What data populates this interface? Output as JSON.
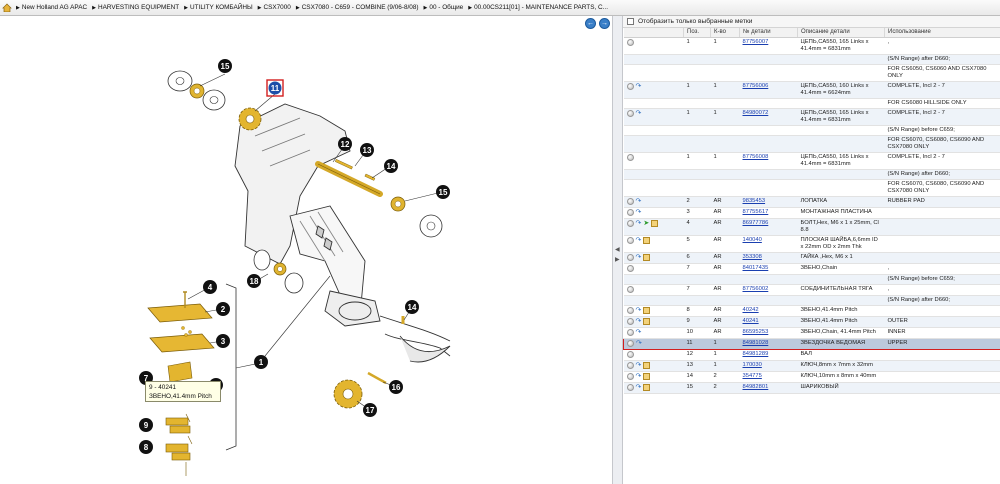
{
  "breadcrumb": [
    "New Holland AG APAC",
    "HARVESTING EQUIPMENT",
    "UTILITY КОМБАЙНЫ",
    "CSX7000",
    "CSX7080 - C659 - COMBINE (9/06-8/08)",
    "00 - Общие",
    "00.00CS211[01] - MAINTENANCE PARTS, C..."
  ],
  "diagram": {
    "callouts": [
      "15",
      "11",
      "12",
      "13",
      "14",
      "15",
      "18",
      "4",
      "2",
      "3",
      "1",
      "7",
      "5",
      "9",
      "8",
      "14",
      "16",
      "17"
    ],
    "tooltip_line1": "9 - 40241",
    "tooltip_line2": "ЗВЕНО,41.4mm Pitch",
    "nav_prev": "←",
    "nav_next": "→"
  },
  "filter": {
    "label": "Отобразить только выбранные метки"
  },
  "table": {
    "headers": [
      "",
      "Поз.",
      "К-во",
      "№ детали",
      "Описание детали",
      "Использование"
    ],
    "rows": [
      {
        "icons": [
          "circle"
        ],
        "pos": "1",
        "qty": "1",
        "part": "87756007",
        "desc": "ЦЕПЬ,CA550, 165 Links x 41.4mm = 6831mm",
        "use": ","
      },
      {
        "icons": [],
        "pos": "",
        "qty": "",
        "part": "",
        "desc": "",
        "use": "(S/N Range) after D660;"
      },
      {
        "icons": [],
        "pos": "",
        "qty": "",
        "part": "",
        "desc": "",
        "use": "FOR CS6050, CS6060 AND CSX7080 ONLY"
      },
      {
        "icons": [
          "circle",
          "arrow"
        ],
        "pos": "1",
        "qty": "1",
        "part": "87756006",
        "desc": "ЦЕПЬ,CA550, 160 Links x 41.4mm = 6624mm",
        "use": "COMPLETE, Incl 2 - 7"
      },
      {
        "icons": [],
        "pos": "",
        "qty": "",
        "part": "",
        "desc": "",
        "use": "FOR CS6080 HILLSIDE ONLY"
      },
      {
        "icons": [
          "circle",
          "arrow"
        ],
        "pos": "1",
        "qty": "1",
        "part": "84980072",
        "desc": "ЦЕПЬ,CA550, 165 Links x 41.4mm = 6831mm",
        "use": "COMPLETE, Incl 2 - 7"
      },
      {
        "icons": [],
        "pos": "",
        "qty": "",
        "part": "",
        "desc": "",
        "use": "(S/N Range) before C659;"
      },
      {
        "icons": [],
        "pos": "",
        "qty": "",
        "part": "",
        "desc": "",
        "use": "FOR CS6070, CS6080, CS6090 AND CSX7080 ONLY"
      },
      {
        "icons": [
          "circle"
        ],
        "pos": "1",
        "qty": "1",
        "part": "87756008",
        "desc": "ЦЕПЬ,CA550, 165 Links x 41.4mm = 6831mm",
        "use": "COMPLETE, Incl 2 - 7"
      },
      {
        "icons": [],
        "pos": "",
        "qty": "",
        "part": "",
        "desc": "",
        "use": "(S/N Range) after D660;"
      },
      {
        "icons": [],
        "pos": "",
        "qty": "",
        "part": "",
        "desc": "",
        "use": "FOR CS6070, CS6080, CS6090 AND CSX7080 ONLY"
      },
      {
        "icons": [
          "circle",
          "arrow"
        ],
        "pos": "2",
        "qty": "AR",
        "part": "9835453",
        "desc": "ЛОПАТКА",
        "use": "RUBBER PAD"
      },
      {
        "icons": [
          "circle",
          "arrow"
        ],
        "pos": "3",
        "qty": "AR",
        "part": "87755617",
        "desc": "МОНТАЖНАЯ ПЛАСТИНА",
        "use": ""
      },
      {
        "icons": [
          "circle",
          "arrow",
          "green",
          "box"
        ],
        "pos": "4",
        "qty": "AR",
        "part": "86977786",
        "desc": "БОЛТ,Hex, M6 x 1 x 25mm, Cl 8.8",
        "use": ""
      },
      {
        "icons": [
          "circle",
          "arrow",
          "box"
        ],
        "pos": "5",
        "qty": "AR",
        "part": "140040",
        "desc": "ПЛОСКАЯ ШАЙБА,6,6mm ID x 22mm OD x 2mm Thk",
        "use": ""
      },
      {
        "icons": [
          "circle",
          "arrow",
          "box"
        ],
        "pos": "6",
        "qty": "AR",
        "part": "353308",
        "desc": "ГАЙКА ,Hex, M6 x 1",
        "use": ""
      },
      {
        "icons": [
          "circle"
        ],
        "pos": "7",
        "qty": "AR",
        "part": "84017435",
        "desc": "ЗВЕНО,Chain",
        "use": ","
      },
      {
        "icons": [],
        "pos": "",
        "qty": "",
        "part": "",
        "desc": "",
        "use": "(S/N Range) before C659;"
      },
      {
        "icons": [
          "circle"
        ],
        "pos": "7",
        "qty": "AR",
        "part": "87756002",
        "desc": "СОЕДИНИТЕЛЬНАЯ ТЯГА",
        "use": ","
      },
      {
        "icons": [],
        "pos": "",
        "qty": "",
        "part": "",
        "desc": "",
        "use": "(S/N Range) after D660;"
      },
      {
        "icons": [
          "circle",
          "arrow",
          "box"
        ],
        "pos": "8",
        "qty": "AR",
        "part": "40242",
        "desc": "ЗВЕНО,41.4mm Pitch",
        "use": ""
      },
      {
        "icons": [
          "circle",
          "arrow",
          "box"
        ],
        "pos": "9",
        "qty": "AR",
        "part": "40241",
        "desc": "ЗВЕНО,41.4mm Pitch",
        "use": "OUTER"
      },
      {
        "icons": [
          "circle",
          "arrow"
        ],
        "pos": "10",
        "qty": "AR",
        "part": "86595253",
        "desc": "ЗВЕНО,Chain, 41.4mm Pitch",
        "use": "INNER"
      },
      {
        "icons": [
          "circle",
          "arrow"
        ],
        "pos": "11",
        "qty": "1",
        "part": "84981028",
        "desc": "ЗВЕЗДОЧКА ВЕДОМАЯ",
        "use": "UPPER",
        "selected": true
      },
      {
        "icons": [
          "circle"
        ],
        "pos": "12",
        "qty": "1",
        "part": "84981289",
        "desc": "ВАЛ",
        "use": ""
      },
      {
        "icons": [
          "circle",
          "arrow",
          "box"
        ],
        "pos": "13",
        "qty": "1",
        "part": "170030",
        "desc": "КЛЮЧ,8mm x 7mm x 32mm",
        "use": ""
      },
      {
        "icons": [
          "circle",
          "arrow",
          "box"
        ],
        "pos": "14",
        "qty": "2",
        "part": "354775",
        "desc": "КЛЮЧ,10mm x 8mm x 40mm",
        "use": ""
      },
      {
        "icons": [
          "circle",
          "arrow",
          "box"
        ],
        "pos": "15",
        "qty": "2",
        "part": "84982801",
        "desc": "ШАРИКОВЫЙ",
        "use": ""
      }
    ]
  }
}
